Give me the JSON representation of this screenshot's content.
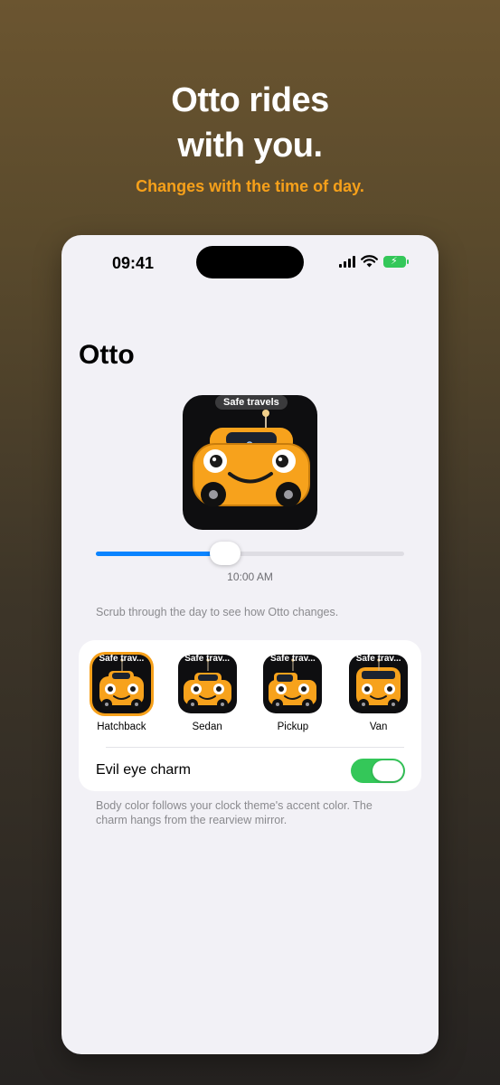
{
  "hero": {
    "title_line1": "Otto rides",
    "title_line2": "with you.",
    "subtitle": "Changes with the time of day."
  },
  "status_bar": {
    "time": "09:41",
    "icons": [
      "cellular-signal-icon",
      "wifi-icon",
      "battery-charging-icon"
    ]
  },
  "page": {
    "title": "Otto"
  },
  "preview": {
    "bubble": "Safe travels"
  },
  "time_slider": {
    "value_label": "10:00 AM",
    "fraction": 0.42
  },
  "hint": "Scrub through the day to see how Otto changes.",
  "vehicle_styles": {
    "tile_label": "Safe trav...",
    "items": [
      {
        "name": "Hatchback",
        "selected": true
      },
      {
        "name": "Sedan",
        "selected": false
      },
      {
        "name": "Pickup",
        "selected": false
      },
      {
        "name": "Van",
        "selected": false
      }
    ]
  },
  "charm_toggle": {
    "label": "Evil eye charm",
    "on": true
  },
  "footnote": "Body color follows your clock theme's accent color. The charm hangs from the rearview mirror.",
  "colors": {
    "accent": "#f6a01a",
    "car_body": "#f7a21c",
    "slider_fill": "#0a84ff",
    "toggle_on": "#34c759",
    "battery": "#34c759"
  }
}
